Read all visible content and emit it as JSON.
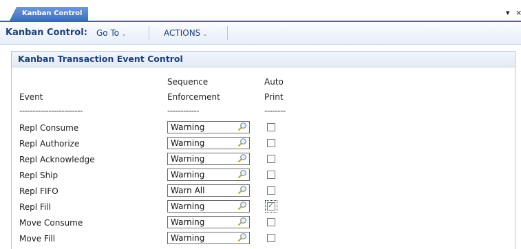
{
  "tab": {
    "label": "Kanban Control",
    "dropdown_glyph": "▾",
    "close_glyph": "×"
  },
  "toolbar": {
    "title": "Kanban Control:",
    "goto_label": "Go To",
    "actions_label": "ACTIONS"
  },
  "panel": {
    "title": "Kanban Transaction Event Control",
    "columns": {
      "event": {
        "line1": "",
        "line2": "Event",
        "rule": "------------------------"
      },
      "sequence": {
        "line1": "Sequence",
        "line2": "Enforcement",
        "rule": "------------"
      },
      "auto": {
        "line1": "Auto",
        "line2": "Print",
        "rule": "--------"
      }
    },
    "rows": [
      {
        "event": "Repl Consume",
        "sequence": "Warning",
        "auto_print": false
      },
      {
        "event": "Repl Authorize",
        "sequence": "Warning",
        "auto_print": false
      },
      {
        "event": "Repl Acknowledge",
        "sequence": "Warning",
        "auto_print": false
      },
      {
        "event": "Repl Ship",
        "sequence": "Warning",
        "auto_print": false
      },
      {
        "event": "Repl FIFO",
        "sequence": "Warn All",
        "auto_print": false
      },
      {
        "event": "Repl Fill",
        "sequence": "Warning",
        "auto_print": true
      },
      {
        "event": "Move Consume",
        "sequence": "Warning",
        "auto_print": false
      },
      {
        "event": "Move Fill",
        "sequence": "Warning",
        "auto_print": false
      }
    ]
  },
  "icons": {
    "lookup": "magnifier-icon",
    "check": "✓"
  }
}
